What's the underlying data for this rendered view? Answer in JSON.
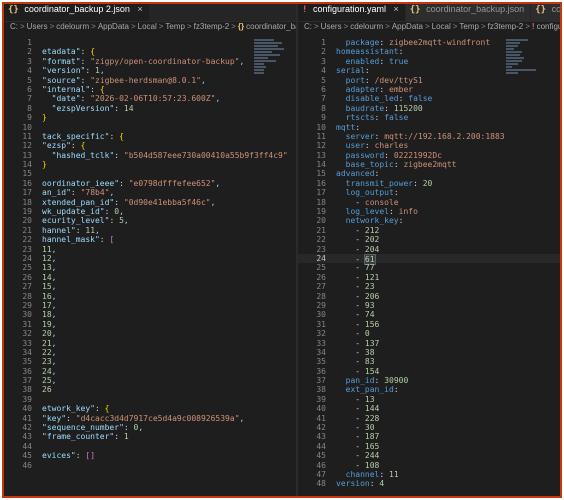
{
  "left": {
    "tab": {
      "icon": "{}",
      "label": "coordinator_backup 2.json"
    },
    "breadcrumb": [
      "C:",
      "Users",
      "cdelourm",
      "AppData",
      "Local",
      "Temp",
      "fz3temp-2",
      "coordinator_backup 2.json"
    ],
    "breadcrumb_icon": "{}",
    "lines": [
      {
        "n": "1",
        "t": ""
      },
      {
        "n": "2",
        "t": "etadata\": {"
      },
      {
        "n": "3",
        "t": "\"format\": \"zigpy/open-coordinator-backup\","
      },
      {
        "n": "4",
        "t": "\"version\": 1,"
      },
      {
        "n": "5",
        "t": "\"source\": \"zigbee-herdsman@8.0.1\","
      },
      {
        "n": "6",
        "t": "\"internal\": {"
      },
      {
        "n": "7",
        "t": "  \"date\": \"2026-02-06T10:57:23.600Z\","
      },
      {
        "n": "8",
        "t": "  \"ezspVersion\": 14"
      },
      {
        "n": "9",
        "t": "}"
      },
      {
        "n": "10",
        "t": ""
      },
      {
        "n": "11",
        "t": "tack_specific\": {"
      },
      {
        "n": "12",
        "t": "\"ezsp\": {"
      },
      {
        "n": "13",
        "t": "  \"hashed_tclk\": \"b504d587eee730a00410a55b9f3ff4c9\""
      },
      {
        "n": "14",
        "t": "}"
      },
      {
        "n": "15",
        "t": ""
      },
      {
        "n": "16",
        "t": "oordinator_ieee\": \"e0798dfffefee652\","
      },
      {
        "n": "17",
        "t": "an_id\": \"78b4\","
      },
      {
        "n": "18",
        "t": "xtended_pan_id\": \"0d90e41ebba5f46c\","
      },
      {
        "n": "19",
        "t": "wk_update_id\": 0,"
      },
      {
        "n": "20",
        "t": "ecurity_level\": 5,"
      },
      {
        "n": "21",
        "t": "hannel\": 11,"
      },
      {
        "n": "22",
        "t": "hannel_mask\": ["
      },
      {
        "n": "23",
        "t": "11,"
      },
      {
        "n": "24",
        "t": "12,"
      },
      {
        "n": "25",
        "t": "13,"
      },
      {
        "n": "26",
        "t": "14,"
      },
      {
        "n": "27",
        "t": "15,"
      },
      {
        "n": "28",
        "t": "16,"
      },
      {
        "n": "29",
        "t": "17,"
      },
      {
        "n": "30",
        "t": "18,"
      },
      {
        "n": "31",
        "t": "19,"
      },
      {
        "n": "32",
        "t": "20,"
      },
      {
        "n": "33",
        "t": "21,"
      },
      {
        "n": "34",
        "t": "22,"
      },
      {
        "n": "35",
        "t": "23,"
      },
      {
        "n": "36",
        "t": "24,"
      },
      {
        "n": "37",
        "t": "25,"
      },
      {
        "n": "38",
        "t": "26"
      },
      {
        "n": "39",
        "t": ""
      },
      {
        "n": "40",
        "t": "etwork_key\": {"
      },
      {
        "n": "41",
        "t": "\"key\": \"d4cacc3d4d7917ce5d4a9c008926539a\","
      },
      {
        "n": "42",
        "t": "\"sequence_number\": 0,"
      },
      {
        "n": "43",
        "t": "\"frame_counter\": 1"
      },
      {
        "n": "44",
        "t": ""
      },
      {
        "n": "45",
        "t": "evices\": []"
      },
      {
        "n": "46",
        "t": ""
      }
    ]
  },
  "right": {
    "tabs": [
      {
        "icon": "!",
        "label": "configuration.yaml",
        "active": true
      },
      {
        "icon": "{}",
        "label": "coordinator_backup.json",
        "active": false
      },
      {
        "icon": "{}",
        "label": "coordinator_back",
        "active": false
      }
    ],
    "breadcrumb": [
      "C:",
      "Users",
      "cdelourm",
      "AppData",
      "Local",
      "Temp",
      "fz3temp-2",
      "configuration.yaml"
    ],
    "breadcrumb_icon": "!",
    "lines": [
      {
        "n": "1",
        "t": "  package: zigbee2mqtt-windfront"
      },
      {
        "n": "2",
        "t": "homeassistant:"
      },
      {
        "n": "3",
        "t": "  enabled: true"
      },
      {
        "n": "4",
        "t": "serial:"
      },
      {
        "n": "5",
        "t": "  port: /dev/ttyS1"
      },
      {
        "n": "6",
        "t": "  adapter: ember"
      },
      {
        "n": "7",
        "t": "  disable_led: false"
      },
      {
        "n": "8",
        "t": "  baudrate: 115200"
      },
      {
        "n": "9",
        "t": "  rtscts: false"
      },
      {
        "n": "10",
        "t": "mqtt:"
      },
      {
        "n": "11",
        "t": "  server: mqtt://192.168.2.200:1883"
      },
      {
        "n": "12",
        "t": "  user: charles"
      },
      {
        "n": "13",
        "t": "  password: 02221992Dc"
      },
      {
        "n": "14",
        "t": "  base_topic: zigbee2mqtt"
      },
      {
        "n": "15",
        "t": "advanced:"
      },
      {
        "n": "16",
        "t": "  transmit_power: 20"
      },
      {
        "n": "17",
        "t": "  log_output:"
      },
      {
        "n": "18",
        "t": "    - console"
      },
      {
        "n": "19",
        "t": "  log_level: info"
      },
      {
        "n": "20",
        "t": "  network_key:"
      },
      {
        "n": "21",
        "t": "    - 212"
      },
      {
        "n": "22",
        "t": "    - 202"
      },
      {
        "n": "23",
        "t": "    - 204"
      },
      {
        "n": "24",
        "t": "    - 61"
      },
      {
        "n": "25",
        "t": "    - 77"
      },
      {
        "n": "26",
        "t": "    - 121"
      },
      {
        "n": "27",
        "t": "    - 23"
      },
      {
        "n": "28",
        "t": "    - 206"
      },
      {
        "n": "29",
        "t": "    - 93"
      },
      {
        "n": "30",
        "t": "    - 74"
      },
      {
        "n": "31",
        "t": "    - 156"
      },
      {
        "n": "32",
        "t": "    - 0"
      },
      {
        "n": "33",
        "t": "    - 137"
      },
      {
        "n": "34",
        "t": "    - 38"
      },
      {
        "n": "35",
        "t": "    - 83"
      },
      {
        "n": "36",
        "t": "    - 154"
      },
      {
        "n": "37",
        "t": "  pan_id: 30900"
      },
      {
        "n": "38",
        "t": "  ext_pan_id:"
      },
      {
        "n": "39",
        "t": "    - 13"
      },
      {
        "n": "40",
        "t": "    - 144"
      },
      {
        "n": "41",
        "t": "    - 228"
      },
      {
        "n": "42",
        "t": "    - 30"
      },
      {
        "n": "43",
        "t": "    - 187"
      },
      {
        "n": "44",
        "t": "    - 165"
      },
      {
        "n": "45",
        "t": "    - 244"
      },
      {
        "n": "46",
        "t": "    - 108"
      },
      {
        "n": "47",
        "t": "  channel: 11"
      },
      {
        "n": "48",
        "t": "version: 4"
      }
    ],
    "current_line": "24"
  },
  "colors": {
    "frame_border": "#c8380e",
    "editor_bg": "#1e1e1e",
    "json_key": "#9cdcfe",
    "string": "#ce9178",
    "number": "#b5cea8",
    "yaml_key": "#569cd6"
  }
}
